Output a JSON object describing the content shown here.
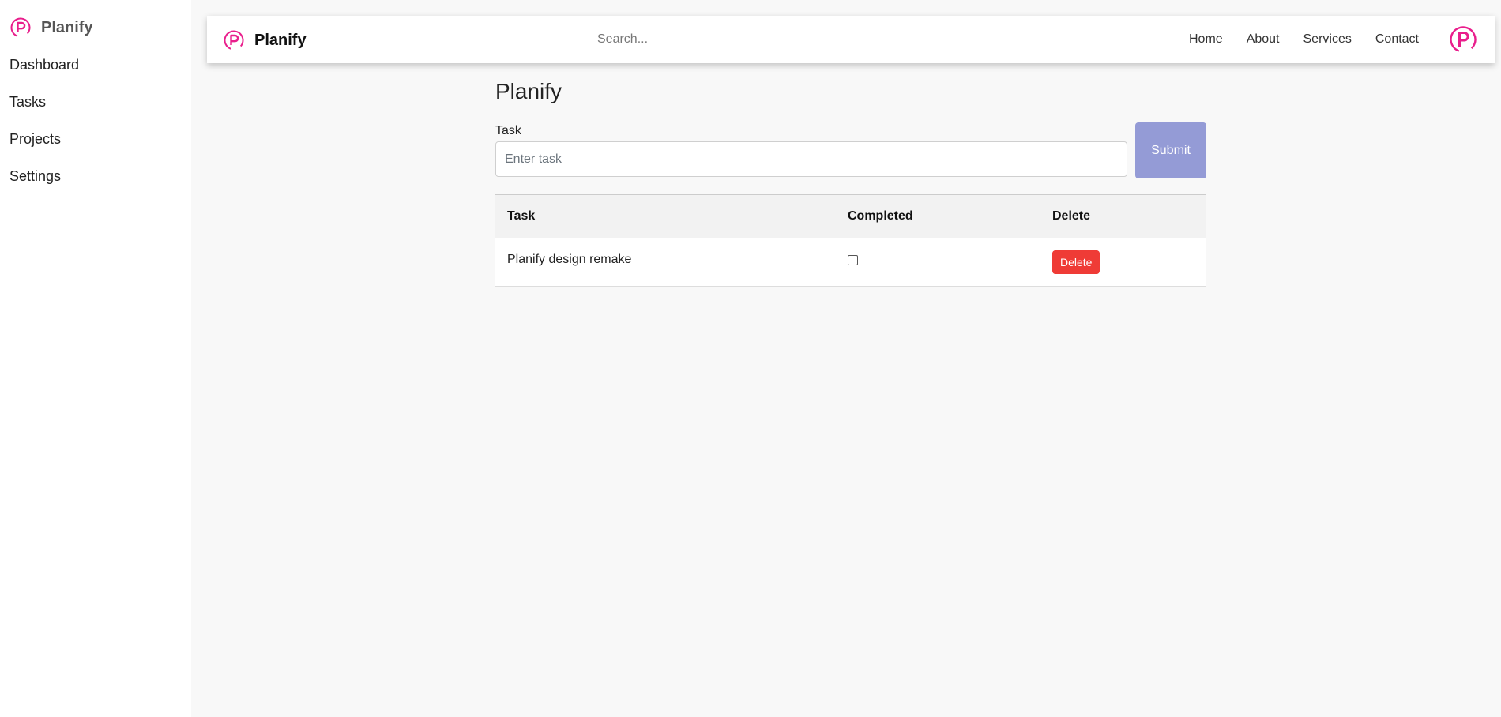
{
  "colors": {
    "brand_pink": "#e91e8c",
    "submit": "#949bd6",
    "delete": "#ef3b36"
  },
  "sidebar": {
    "brand": "Planify",
    "logo_icon": "planify-logo-icon",
    "items": [
      {
        "label": "Dashboard"
      },
      {
        "label": "Tasks"
      },
      {
        "label": "Projects"
      },
      {
        "label": "Settings"
      }
    ]
  },
  "topbar": {
    "brand": "Planify",
    "search_placeholder": "Search...",
    "nav": [
      {
        "label": "Home"
      },
      {
        "label": "About"
      },
      {
        "label": "Services"
      },
      {
        "label": "Contact"
      }
    ],
    "avatar_icon": "planify-avatar-icon"
  },
  "main": {
    "title": "Planify",
    "form": {
      "label": "Task",
      "placeholder": "Enter task",
      "value": "",
      "submit_label": "Submit"
    },
    "table": {
      "headers": [
        "Task",
        "Completed",
        "Delete"
      ],
      "rows": [
        {
          "task": "Planify design remake",
          "completed": false,
          "delete_label": "Delete"
        }
      ]
    }
  }
}
